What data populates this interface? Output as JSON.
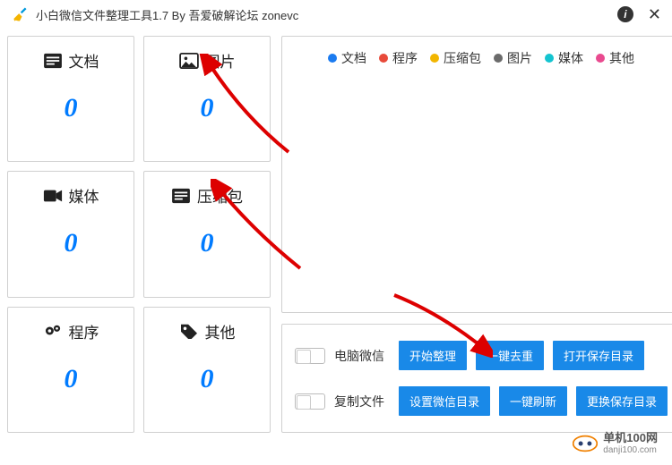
{
  "title": "小白微信文件整理工具1.7 By 吾爱破解论坛  zonevc",
  "tiles": [
    {
      "label": "文档",
      "count": "0"
    },
    {
      "label": "图片",
      "count": "0"
    },
    {
      "label": "媒体",
      "count": "0"
    },
    {
      "label": "压缩包",
      "count": "0"
    },
    {
      "label": "程序",
      "count": "0"
    },
    {
      "label": "其他",
      "count": "0"
    }
  ],
  "legend": [
    {
      "label": "文档",
      "color": "#1b7bf0"
    },
    {
      "label": "程序",
      "color": "#e84a3a"
    },
    {
      "label": "压缩包",
      "color": "#f2b600"
    },
    {
      "label": "图片",
      "color": "#6b6b6b"
    },
    {
      "label": "媒体",
      "color": "#14c4d0"
    },
    {
      "label": "其他",
      "color": "#e94a8f"
    }
  ],
  "controls": {
    "toggle1": "电脑微信",
    "toggle2": "复制文件",
    "btn_start": "开始整理",
    "btn_dedup": "一键去重",
    "btn_open_save": "打开保存目录",
    "btn_set_wechat": "设置微信目录",
    "btn_refresh": "一键刷新",
    "btn_change_save": "更换保存目录"
  },
  "watermark": {
    "cn": "单机100网",
    "en": "danji100.com"
  }
}
